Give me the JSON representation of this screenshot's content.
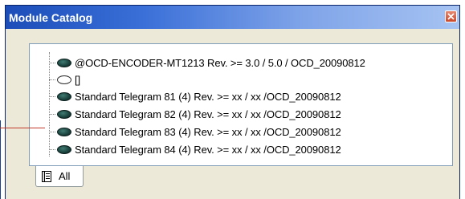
{
  "window": {
    "title": "Module Catalog"
  },
  "catalog": {
    "items": [
      {
        "label": "@OCD-ENCODER-MT1213 Rev. >= 3.0 / 5.0 / OCD_20090812",
        "icon": "module-filled"
      },
      {
        "label": "[]",
        "icon": "module-empty"
      },
      {
        "label": "Standard Telegram 81 (4) Rev. >= xx / xx /OCD_20090812",
        "icon": "module-filled"
      },
      {
        "label": "Standard Telegram 82 (4) Rev. >= xx / xx /OCD_20090812",
        "icon": "module-filled"
      },
      {
        "label": "Standard Telegram 83 (4) Rev. >= xx / xx /OCD_20090812",
        "icon": "module-filled"
      },
      {
        "label": "Standard Telegram 84 (4) Rev. >= xx / xx /OCD_20090812",
        "icon": "module-filled"
      }
    ]
  },
  "tabs": {
    "active": "All"
  },
  "colors": {
    "title_bar": "#1c4db8",
    "callout": "#c0392b"
  }
}
